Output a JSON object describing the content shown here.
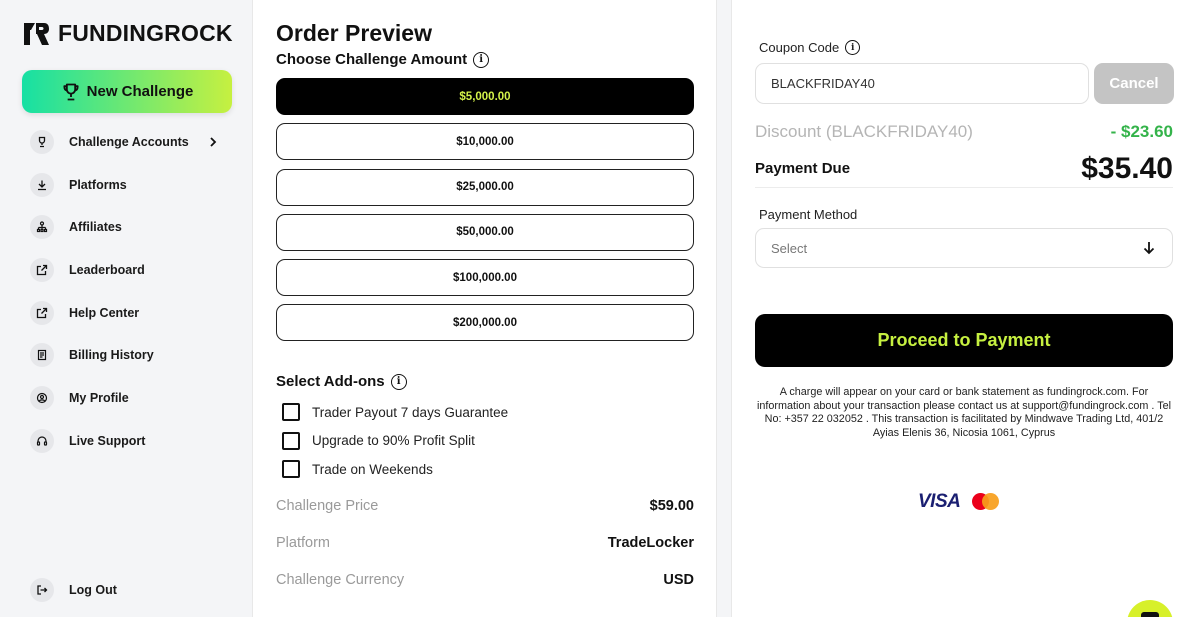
{
  "brand": {
    "name": "FUNDINGROCK"
  },
  "sidebar": {
    "new_challenge_label": "New Challenge",
    "items": [
      {
        "label": "Challenge Accounts",
        "icon": "trophy-icon",
        "has_chevron": true
      },
      {
        "label": "Platforms",
        "icon": "download-icon"
      },
      {
        "label": "Affiliates",
        "icon": "network-icon"
      },
      {
        "label": "Leaderboard",
        "icon": "external-link-icon"
      },
      {
        "label": "Help Center",
        "icon": "external-link-icon"
      },
      {
        "label": "Billing History",
        "icon": "receipt-icon"
      },
      {
        "label": "My Profile",
        "icon": "user-circle-icon"
      },
      {
        "label": "Live Support",
        "icon": "headset-icon"
      }
    ],
    "logout_label": "Log Out"
  },
  "order": {
    "title": "Order Preview",
    "choose_label": "Choose Challenge Amount",
    "amounts": [
      "$5,000.00",
      "$10,000.00",
      "$25,000.00",
      "$50,000.00",
      "$100,000.00",
      "$200,000.00"
    ],
    "selected_amount_index": 0,
    "addons_title": "Select Add-ons",
    "addons": [
      {
        "label": "Trader Payout 7 days Guarantee",
        "checked": false
      },
      {
        "label": "Upgrade to 90% Profit Split",
        "checked": false
      },
      {
        "label": "Trade on Weekends",
        "checked": false
      }
    ],
    "summary": [
      {
        "key": "Challenge Price",
        "value": "$59.00"
      },
      {
        "key": "Platform",
        "value": "TradeLocker"
      },
      {
        "key": "Challenge Currency",
        "value": "USD"
      }
    ]
  },
  "payment": {
    "coupon_label": "Coupon Code",
    "coupon_value": "BLACKFRIDAY40",
    "cancel_label": "Cancel",
    "discount_label": "Discount (BLACKFRIDAY40)",
    "discount_value": "- $23.60",
    "due_label": "Payment Due",
    "due_value": "$35.40",
    "method_label": "Payment Method",
    "method_value": "Select",
    "proceed_label": "Proceed to Payment",
    "disclaimer": "A charge will appear on your card or bank statement as fundingrock.com. For information about your transaction please contact us at support@fundingrock.com . Tel No: +357 22 032052 . This transaction is facilitated by Mindwave Trading Ltd, 401/2 Ayias Elenis 36, Nicosia 1061, Cyprus",
    "card_brands": [
      "VISA",
      "mastercard"
    ]
  },
  "colors": {
    "accent_lime": "#c6f040",
    "accent_green": "#16e0a4",
    "discount_green": "#34b34a",
    "primary_dark": "#000000"
  }
}
